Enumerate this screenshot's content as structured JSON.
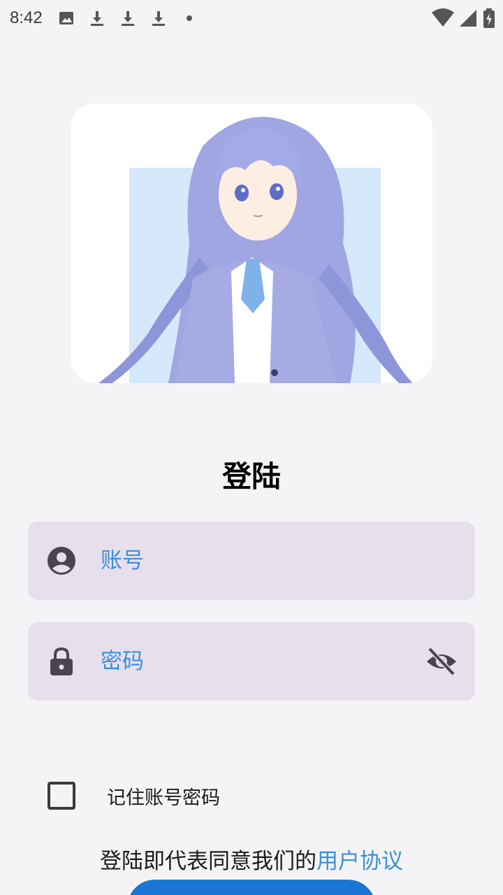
{
  "status_bar": {
    "time": "8:42",
    "icons_left": [
      "image-icon",
      "download-icon",
      "download-icon",
      "download-icon",
      "dot-icon"
    ],
    "icons_right": [
      "wifi-icon",
      "signal-icon",
      "battery-charging-icon"
    ]
  },
  "hero": {
    "description_icon": "anime-girl-illustration"
  },
  "title": "登陆",
  "account_field": {
    "icon": "account-circle-icon",
    "placeholder": "账号",
    "value": ""
  },
  "password_field": {
    "icon": "lock-icon",
    "placeholder": "密码",
    "value": "",
    "trailing_icon": "visibility-off-icon"
  },
  "remember": {
    "label": "记住账号密码",
    "checked": false
  },
  "agreement": {
    "prefix": "登陆即代表同意我们的",
    "link": "用户协议"
  },
  "colors": {
    "background": "#f4f4f6",
    "field_background": "#e7dfec",
    "accent": "#3b8fd9",
    "button": "#1976d2"
  }
}
